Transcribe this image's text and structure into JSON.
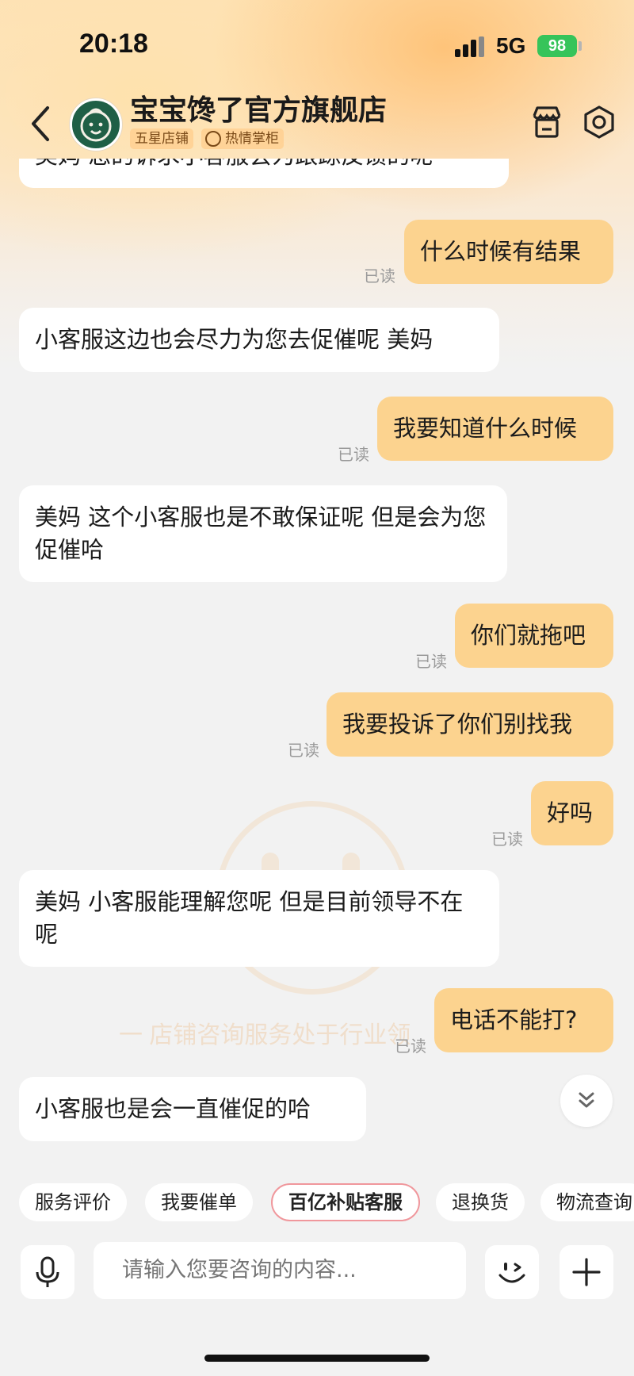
{
  "status_bar": {
    "time": "20:18",
    "network": "5G",
    "battery": "98"
  },
  "header": {
    "shop_name": "宝宝馋了官方旗舰店",
    "badges": [
      "五星店铺",
      "热情掌柜"
    ]
  },
  "watermark": {
    "text": "一  店铺咨询服务处于行业领"
  },
  "messages": [
    {
      "from": "shop",
      "text": "美妈 您的诉求小客服会为跟踪反馈的呢"
    },
    {
      "from": "user",
      "text": "什么时候有结果",
      "status": "已读"
    },
    {
      "from": "shop",
      "text": "小客服这边也会尽力为您去促催呢 美妈"
    },
    {
      "from": "user",
      "text": "我要知道什么时候",
      "status": "已读"
    },
    {
      "from": "shop",
      "text": "美妈  这个小客服也是不敢保证呢 但是会为您促催哈"
    },
    {
      "from": "user",
      "text": "你们就拖吧",
      "status": "已读"
    },
    {
      "from": "user",
      "text": "我要投诉了你们别找我",
      "status": "已读"
    },
    {
      "from": "user",
      "text": "好吗",
      "status": "已读"
    },
    {
      "from": "shop",
      "text": "美妈 小客服能理解您呢 但是目前领导不在呢"
    },
    {
      "from": "user",
      "text": "电话不能打?",
      "status": "已读"
    },
    {
      "from": "shop",
      "text": "小客服也是会一直催促的哈"
    }
  ],
  "quick_actions": [
    "服务评价",
    "我要催单",
    "百亿补贴客服",
    "退换货",
    "物流查询"
  ],
  "input": {
    "placeholder": "请输入您要咨询的内容..."
  }
}
